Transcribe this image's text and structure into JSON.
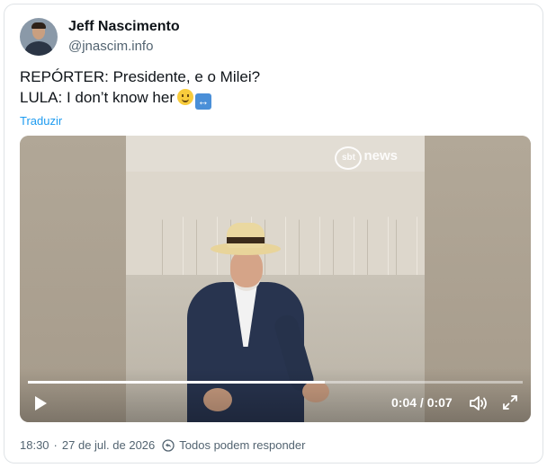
{
  "author": {
    "name": "Jeff Nascimento",
    "handle": "@jnascim.info",
    "avatar_icon": "profile-photo-avatar"
  },
  "tweet": {
    "line1": "REPÓRTER: Presidente, e o Milei?",
    "line2": "LULA: I don’t know her",
    "emoji1": "slightly-smiling-face-emoji",
    "emoji2": "left-right-arrow-emoji",
    "translate_label": "Traduzir"
  },
  "video": {
    "watermark": "news",
    "watermark_logo": "sbt",
    "time_display": "0:04 / 0:07",
    "progress_fraction": 0.6,
    "play_icon": "play-icon",
    "volume_icon": "volume-icon",
    "fullscreen_icon": "fullscreen-icon"
  },
  "meta": {
    "time": "18:30",
    "separator": "·",
    "date": "27 de jul. de 2026",
    "reply_setting": "Todos podem responder",
    "reply_icon": "globe-reply-icon"
  },
  "colors": {
    "link": "#1d9bf0",
    "secondary_text": "#536471",
    "border": "#dfe3e6"
  }
}
